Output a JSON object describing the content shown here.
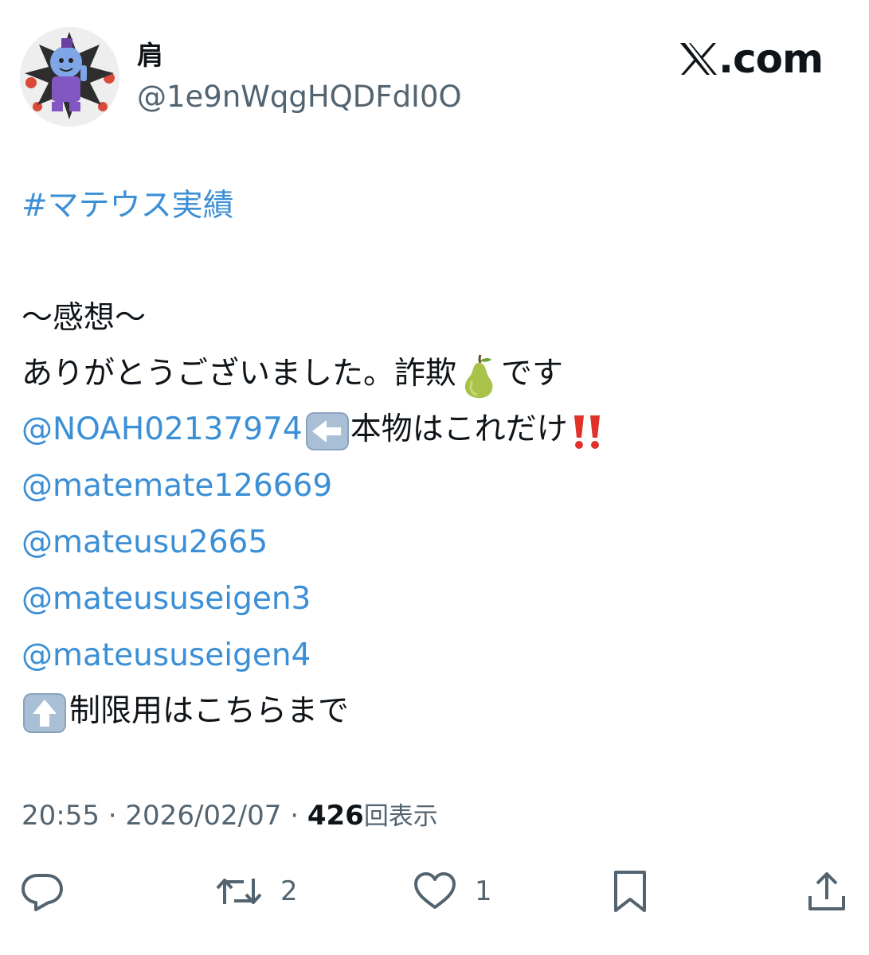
{
  "tweet": {
    "author": {
      "display_name": "肩",
      "handle": "@1e9nWqgHQDFdI0O"
    },
    "brand": {
      "x_glyph": "𝕏",
      "domain_suffix": ".com"
    },
    "hashtag": "#マテウス実績",
    "lines": {
      "heading": "〜感想〜",
      "thanks_part1": "ありがとうございました。詐欺",
      "thanks_emoji": "pear-emoji",
      "thanks_part2": "です",
      "mention_main": "@NOAH02137974",
      "main_arrow_emoji": "left-arrow-emoji",
      "main_suffix": "本物はこれだけ",
      "main_exclaim_emoji": "double-exclamation-emoji",
      "mention_2": "@matemate126669",
      "mention_3": "@mateusu2665",
      "mention_4": "@mateususeigen3",
      "mention_5": "@mateususeigen4",
      "restricted_arrow_emoji": "up-arrow-emoji",
      "restricted_text": "制限用はこちらまで"
    },
    "meta": {
      "time": "20:55",
      "separator": "·",
      "date": "2026/02/07",
      "views_count": "426",
      "views_label": "回表示"
    },
    "actions": {
      "reply_icon": "reply-icon",
      "retweet_icon": "retweet-icon",
      "retweet_count": "2",
      "like_icon": "heart-icon",
      "like_count": "1",
      "bookmark_icon": "bookmark-icon",
      "share_icon": "share-icon"
    },
    "colors": {
      "link": "#3b8fd6",
      "text": "#0f1419",
      "secondary": "#536471"
    }
  }
}
